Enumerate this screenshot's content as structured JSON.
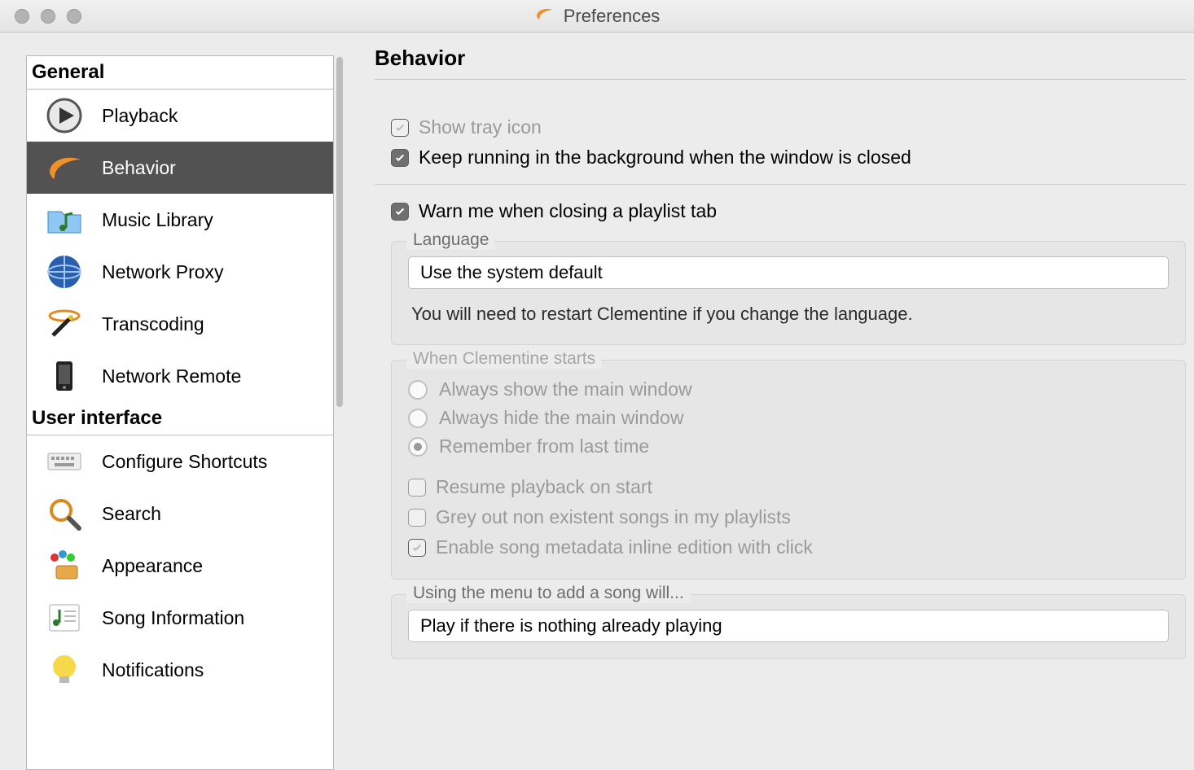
{
  "window": {
    "title": "Preferences"
  },
  "sidebar": {
    "sections": [
      {
        "label": "General",
        "items": [
          {
            "label": "Playback",
            "icon": "play-icon"
          },
          {
            "label": "Behavior",
            "icon": "clementine-icon",
            "selected": true
          },
          {
            "label": "Music Library",
            "icon": "folder-music-icon"
          },
          {
            "label": "Network Proxy",
            "icon": "globe-icon"
          },
          {
            "label": "Transcoding",
            "icon": "wand-icon"
          },
          {
            "label": "Network Remote",
            "icon": "phone-icon"
          }
        ]
      },
      {
        "label": "User interface",
        "items": [
          {
            "label": "Configure Shortcuts",
            "icon": "keyboard-icon"
          },
          {
            "label": "Search",
            "icon": "search-icon"
          },
          {
            "label": "Appearance",
            "icon": "appearance-icon"
          },
          {
            "label": "Song Information",
            "icon": "song-info-icon"
          },
          {
            "label": "Notifications",
            "icon": "bulb-icon"
          }
        ]
      }
    ]
  },
  "main": {
    "title": "Behavior",
    "tray": {
      "show_tray_label": "Show tray icon",
      "show_tray_checked": true,
      "show_tray_disabled": true,
      "keep_running_label": "Keep running in the background when the window is closed",
      "keep_running_checked": true
    },
    "warn_label": "Warn me when closing a playlist tab",
    "warn_checked": true,
    "language": {
      "legend": "Language",
      "value": "Use the system default",
      "hint": "You will need to restart Clementine if you change the language."
    },
    "startup": {
      "legend": "When Clementine starts",
      "disabled": true,
      "options": [
        {
          "label": "Always show the main window",
          "selected": false
        },
        {
          "label": "Always hide the main window",
          "selected": false
        },
        {
          "label": "Remember from last time",
          "selected": true
        }
      ],
      "resume_label": "Resume playback on start",
      "resume_checked": false,
      "grey_label": "Grey out non existent songs in my playlists",
      "grey_checked": false,
      "inline_label": "Enable song metadata inline edition with click",
      "inline_checked": true
    },
    "add_song": {
      "legend": "Using the menu to add a song will...",
      "value": "Play if there is nothing already playing"
    }
  }
}
